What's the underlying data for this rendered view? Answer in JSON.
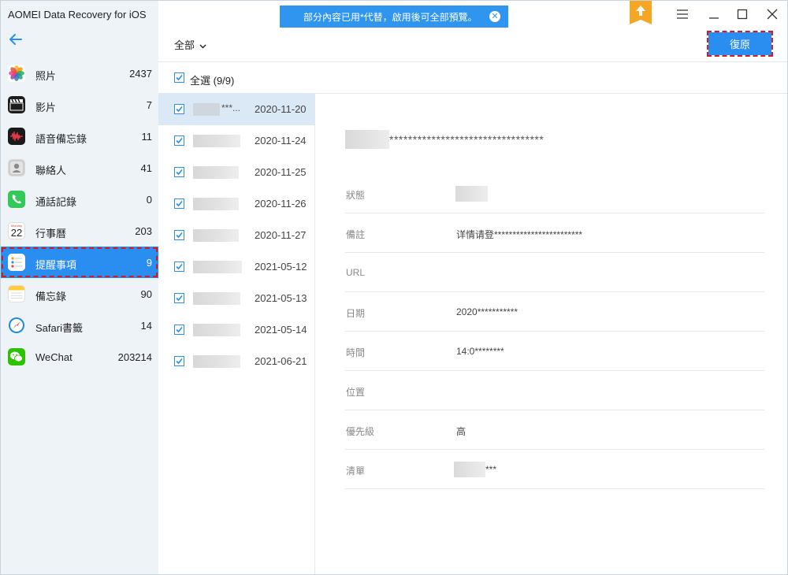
{
  "app": {
    "title": "AOMEI Data Recovery for iOS"
  },
  "notice": {
    "text": "部分內容已用*代替，啟用後可全部預覽。"
  },
  "filter": {
    "label": "全部"
  },
  "restore": {
    "label": "復原"
  },
  "select_all": {
    "label": "全選 (9/9)",
    "checked": true
  },
  "categories": [
    {
      "label": "照片",
      "count": "2437",
      "icon": "photos-icon"
    },
    {
      "label": "影片",
      "count": "7",
      "icon": "video-icon"
    },
    {
      "label": "語音備忘錄",
      "count": "11",
      "icon": "voice-memo-icon"
    },
    {
      "label": "聯絡人",
      "count": "41",
      "icon": "contacts-icon"
    },
    {
      "label": "通話記錄",
      "count": "0",
      "icon": "phone-icon"
    },
    {
      "label": "行事曆",
      "count": "203",
      "icon": "calendar-icon",
      "calendar_day": "22",
      "calendar_weekday": "Monday"
    },
    {
      "label": "提醒事項",
      "count": "9",
      "icon": "reminders-icon",
      "active": true
    },
    {
      "label": "備忘錄",
      "count": "90",
      "icon": "notes-icon"
    },
    {
      "label": "Safari書籤",
      "count": "14",
      "icon": "safari-icon"
    },
    {
      "label": "WeChat",
      "count": "203214",
      "icon": "wechat-icon"
    }
  ],
  "reminders": [
    {
      "stars": "***...",
      "date": "2020-11-20",
      "selected": true
    },
    {
      "stars": "",
      "date": "2020-11-24"
    },
    {
      "stars": "",
      "date": "2020-11-25"
    },
    {
      "stars": "",
      "date": "2020-11-26"
    },
    {
      "stars": "",
      "date": "2020-11-27"
    },
    {
      "stars": "",
      "date": "2021-05-12"
    },
    {
      "stars": "",
      "date": "2021-05-13"
    },
    {
      "stars": "",
      "date": "2021-05-14"
    },
    {
      "stars": "",
      "date": "2021-06-21"
    }
  ],
  "detail": {
    "title_stars": "*********************************",
    "fields": [
      {
        "key": "狀態",
        "value": ""
      },
      {
        "key": "備註",
        "value": "详情请登************************"
      },
      {
        "key": "URL",
        "value": ""
      },
      {
        "key": "日期",
        "value": "2020***********"
      },
      {
        "key": "時間",
        "value": "14:0********"
      },
      {
        "key": "位置",
        "value": ""
      },
      {
        "key": "優先級",
        "value": "高"
      },
      {
        "key": "清單",
        "value": "***"
      }
    ]
  },
  "colors": {
    "accent": "#2a8df0",
    "highlight": "#d11a2a",
    "sidebar_bg": "#eef3f8",
    "selected_row": "#dbe8f5"
  }
}
